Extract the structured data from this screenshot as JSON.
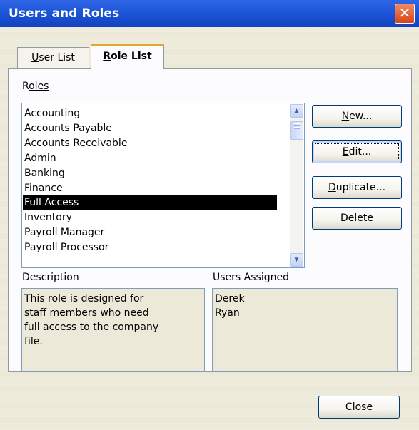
{
  "window": {
    "title": "Users and Roles",
    "close_glyph": "✕"
  },
  "tabs": [
    {
      "label": "User List",
      "accel": "U",
      "rest": "ser List",
      "active": false
    },
    {
      "label": "Role List",
      "accel": "R",
      "rest": "ole List",
      "active": true
    }
  ],
  "roles": {
    "label_accel": "R",
    "label_rest": "oles",
    "items": [
      "Accounting",
      "Accounts Payable",
      "Accounts Receivable",
      "Admin",
      "Banking",
      "Finance",
      "Full Access",
      "Inventory",
      "Payroll Manager",
      "Payroll Processor"
    ],
    "selected": "Full Access"
  },
  "buttons": {
    "new": {
      "pre": "",
      "accel": "N",
      "post": "ew..."
    },
    "edit": {
      "pre": "",
      "accel": "E",
      "post": "dit..."
    },
    "duplicate": {
      "pre": "",
      "accel": "D",
      "post": "uplicate..."
    },
    "delete": {
      "pre": "Del",
      "accel": "e",
      "post": "te"
    },
    "close": {
      "pre": "",
      "accel": "C",
      "post": "lose"
    }
  },
  "description": {
    "label": "Description",
    "text": [
      "This role is designed for",
      "staff members who need",
      "full access to the company",
      "file."
    ]
  },
  "users_assigned": {
    "label": "Users Assigned",
    "users": [
      "Derek",
      "Ryan"
    ]
  },
  "icons": {
    "scroll_up": "▲",
    "scroll_down": "▼"
  }
}
